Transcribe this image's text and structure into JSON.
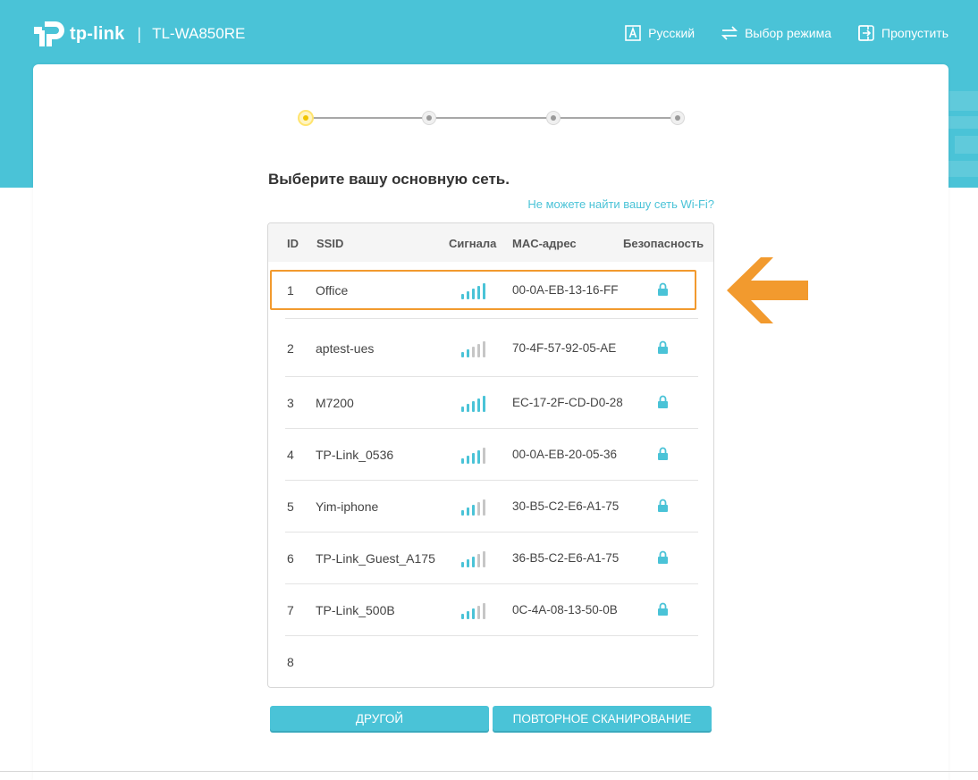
{
  "header": {
    "brand": "tp-link",
    "separator": "|",
    "model": "TL-WA850RE",
    "nav": [
      {
        "label": "Русский",
        "icon": "language-icon"
      },
      {
        "label": "Выбор режима",
        "icon": "mode-switch-icon"
      },
      {
        "label": "Пропустить",
        "icon": "skip-exit-icon"
      }
    ]
  },
  "stepper": {
    "steps": 4,
    "current": 1
  },
  "main": {
    "title": "Выберите вашу основную сеть.",
    "help_link": "Не можете найти вашу сеть Wi-Fi?"
  },
  "table": {
    "headers": {
      "id": "ID",
      "ssid": "SSID",
      "signal": "Сигнала",
      "mac": "MAC-адрес",
      "security": "Безопасность"
    },
    "rows": [
      {
        "id": "1",
        "ssid": "Office",
        "signal": 5,
        "mac": "00-0A-EB-13-16-FF",
        "secured": true
      },
      {
        "id": "2",
        "ssid": "aptest-ues",
        "signal": 2,
        "mac": "70-4F-57-92-05-AE",
        "secured": true
      },
      {
        "id": "3",
        "ssid": "M7200",
        "signal": 5,
        "mac": "EC-17-2F-CD-D0-28",
        "secured": true
      },
      {
        "id": "4",
        "ssid": "TP-Link_0536",
        "signal": 4,
        "mac": "00-0A-EB-20-05-36",
        "secured": true
      },
      {
        "id": "5",
        "ssid": "Yim-iphone",
        "signal": 3,
        "mac": "30-B5-C2-E6-A1-75",
        "secured": true
      },
      {
        "id": "6",
        "ssid": "TP-Link_Guest_A175",
        "signal": 3,
        "mac": "36-B5-C2-E6-A1-75",
        "secured": true
      },
      {
        "id": "7",
        "ssid": "TP-Link_500B",
        "signal": 3,
        "mac": "0C-4A-08-13-50-0B",
        "secured": true
      },
      {
        "id": "8",
        "ssid": "",
        "signal": null,
        "mac": "",
        "secured": false
      }
    ]
  },
  "buttons": {
    "other": "ДРУГОЙ",
    "rescan": "ПОВТОРНОЕ СКАНИРОВАНИЕ"
  },
  "colors": {
    "brand": "#4ac3d7",
    "highlight": "#f29a2e",
    "active_step": "#ffe46e",
    "signal_off": "#c6c6c6"
  }
}
